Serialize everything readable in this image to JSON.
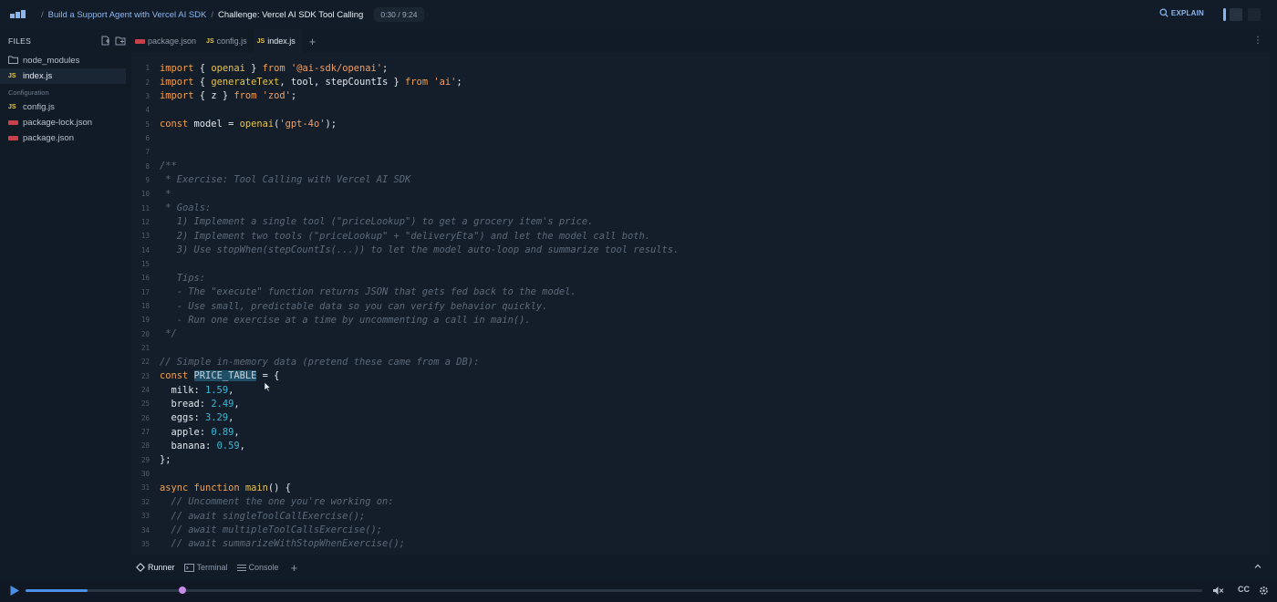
{
  "topbar": {
    "breadcrumb_course": "Build a Support Agent with Vercel AI SDK",
    "breadcrumb_sep": "/",
    "breadcrumb_lesson": "Challenge: Vercel AI SDK Tool Calling",
    "time": "0:30 / 9:24",
    "explain_label": "EXPLAIN"
  },
  "sidebar": {
    "title": "FILES",
    "items": [
      {
        "label": "node_modules",
        "icon": "folder-icon"
      },
      {
        "label": "index.js",
        "icon": "js-icon"
      }
    ],
    "section_label": "Configuration",
    "config_items": [
      {
        "label": "config.js",
        "icon": "js-icon"
      },
      {
        "label": "package-lock.json",
        "icon": "json-icon"
      },
      {
        "label": "package.json",
        "icon": "json-icon"
      }
    ]
  },
  "editor": {
    "tabs": [
      {
        "label": "package.json",
        "icon": "json-icon"
      },
      {
        "label": "config.js",
        "icon": "js-icon"
      },
      {
        "label": "index.js",
        "icon": "js-icon"
      }
    ],
    "js_icon_text": "JS",
    "tab_add": "+",
    "more": "⋮",
    "lines": [
      [
        [
          "kw",
          "import"
        ],
        [
          "pl",
          " { "
        ],
        [
          "fn",
          "openai"
        ],
        [
          "pl",
          " } "
        ],
        [
          "kw",
          "from"
        ],
        [
          "pl",
          " "
        ],
        [
          "str",
          "'@ai-sdk/openai'"
        ],
        [
          "pl",
          ";"
        ]
      ],
      [
        [
          "kw",
          "import"
        ],
        [
          "pl",
          " { "
        ],
        [
          "fn",
          "generateText"
        ],
        [
          "pl",
          ", tool, stepCountIs } "
        ],
        [
          "kw",
          "from"
        ],
        [
          "pl",
          " "
        ],
        [
          "str",
          "'ai'"
        ],
        [
          "pl",
          ";"
        ]
      ],
      [
        [
          "kw",
          "import"
        ],
        [
          "pl",
          " { z } "
        ],
        [
          "kw",
          "from"
        ],
        [
          "pl",
          " "
        ],
        [
          "str",
          "'zod'"
        ],
        [
          "pl",
          ";"
        ]
      ],
      [],
      [
        [
          "kw",
          "const"
        ],
        [
          "pl",
          " model = "
        ],
        [
          "fn",
          "openai"
        ],
        [
          "pl",
          "("
        ],
        [
          "str",
          "'gpt-4o'"
        ],
        [
          "pl",
          ");"
        ]
      ],
      [],
      [],
      [
        [
          "cm",
          "/**"
        ]
      ],
      [
        [
          "cm",
          " * Exercise: Tool Calling with Vercel AI SDK"
        ]
      ],
      [
        [
          "cm",
          " *"
        ]
      ],
      [
        [
          "cm",
          " * Goals:"
        ]
      ],
      [
        [
          "cm",
          "   1) Implement a single tool (\"priceLookup\") to get a grocery item's price."
        ]
      ],
      [
        [
          "cm",
          "   2) Implement two tools (\"priceLookup\" + \"deliveryEta\") and let the model call both."
        ]
      ],
      [
        [
          "cm",
          "   3) Use stopWhen(stepCountIs(...)) to let the model auto-loop and summarize tool results."
        ]
      ],
      [],
      [
        [
          "cm",
          "   Tips:"
        ]
      ],
      [
        [
          "cm",
          "   - The \"execute\" function returns JSON that gets fed back to the model."
        ]
      ],
      [
        [
          "cm",
          "   - Use small, predictable data so you can verify behavior quickly."
        ]
      ],
      [
        [
          "cm",
          "   - Run one exercise at a time by uncommenting a call in main()."
        ]
      ],
      [
        [
          "cm",
          " */"
        ]
      ],
      [],
      [
        [
          "cm",
          "// Simple in-memory data (pretend these came from a DB):"
        ]
      ],
      [
        [
          "kw",
          "const"
        ],
        [
          "pl",
          " "
        ],
        [
          "hl",
          "PRICE_TABLE"
        ],
        [
          "pl",
          " = {"
        ]
      ],
      [
        [
          "pl",
          "  milk: "
        ],
        [
          "num",
          "1.59"
        ],
        [
          "pl",
          ","
        ]
      ],
      [
        [
          "pl",
          "  bread: "
        ],
        [
          "num",
          "2.49"
        ],
        [
          "pl",
          ","
        ]
      ],
      [
        [
          "pl",
          "  eggs: "
        ],
        [
          "num",
          "3.29"
        ],
        [
          "pl",
          ","
        ]
      ],
      [
        [
          "pl",
          "  apple: "
        ],
        [
          "num",
          "0.89"
        ],
        [
          "pl",
          ","
        ]
      ],
      [
        [
          "pl",
          "  banana: "
        ],
        [
          "num",
          "0.59"
        ],
        [
          "pl",
          ","
        ]
      ],
      [
        [
          "pl",
          "};"
        ]
      ],
      [],
      [
        [
          "kw",
          "async function"
        ],
        [
          "pl",
          " "
        ],
        [
          "fn",
          "main"
        ],
        [
          "pl",
          "() {"
        ]
      ],
      [
        [
          "cm",
          "  // Uncomment the one you're working on:"
        ]
      ],
      [
        [
          "cm",
          "  // await singleToolCallExercise();"
        ]
      ],
      [
        [
          "cm",
          "  // await multipleToolCallsExercise();"
        ]
      ],
      [
        [
          "cm",
          "  // await summarizeWithStopWhenExercise();"
        ]
      ]
    ]
  },
  "panel": {
    "tabs": [
      {
        "label": "Runner",
        "icon": "diamond-icon"
      },
      {
        "label": "Terminal",
        "icon": "terminal-icon"
      },
      {
        "label": "Console",
        "icon": "list-icon"
      }
    ],
    "add": "+"
  },
  "player": {
    "progress": 0.053,
    "cc_label": "CC"
  },
  "colors": {
    "accent": "#4a8ee6",
    "keyword": "#f4a04a",
    "function": "#e6c34d",
    "string": "#f29e66",
    "number": "#38b8d6",
    "comment": "#5b6979"
  }
}
